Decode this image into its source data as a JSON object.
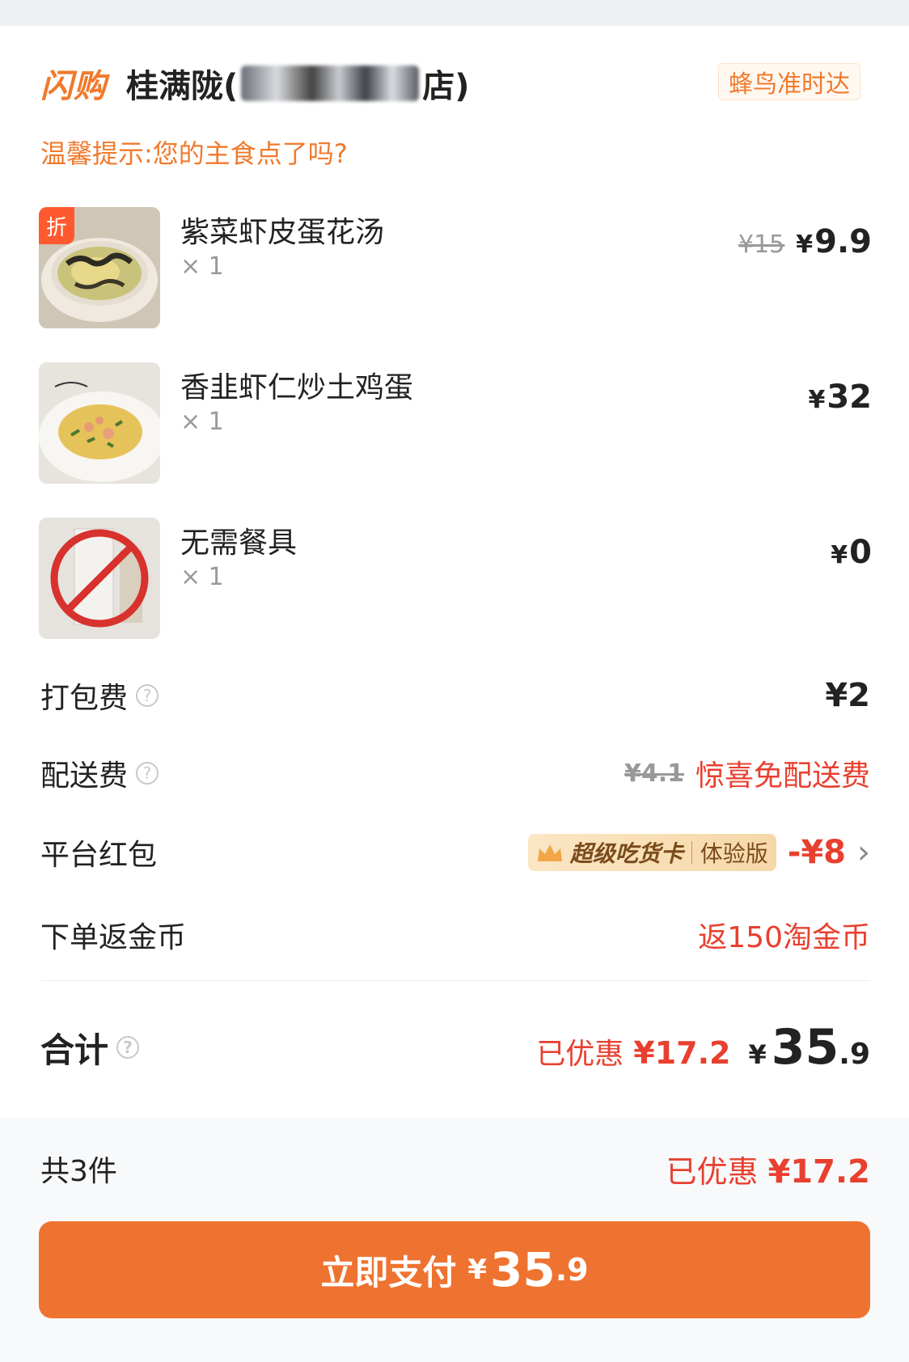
{
  "colors": {
    "accent": "#f07a2c",
    "red": "#e8402f",
    "pay_button": "#ef7330"
  },
  "header": {
    "brand": "闪购",
    "shop_name_prefix": "桂满陇(",
    "shop_name_suffix": "店)",
    "delivery_tag": "蜂鸟准时达"
  },
  "tip": "温馨提示:您的主食点了吗?",
  "items": [
    {
      "name": "紫菜虾皮蛋花汤",
      "qty": "× 1",
      "old_price": "¥15",
      "price_symbol": "¥",
      "price": "9.9",
      "badge": "折",
      "thumb_icon": "soup-image"
    },
    {
      "name": "香韭虾仁炒土鸡蛋",
      "qty": "× 1",
      "price_symbol": "¥",
      "price": "32",
      "thumb_icon": "egg-dish-image"
    },
    {
      "name": "无需餐具",
      "qty": "× 1",
      "price_symbol": "¥",
      "price": "0",
      "thumb_icon": "no-cutlery-image"
    }
  ],
  "fees": {
    "packing": {
      "label": "打包费",
      "value": "¥2"
    },
    "delivery": {
      "label": "配送费",
      "old_value": "¥4.1",
      "value": "惊喜免配送费"
    },
    "red_packet": {
      "label": "平台红包",
      "badge_main": "超级吃货卡",
      "badge_sub": "体验版",
      "value": "-¥8",
      "arrow": "›"
    },
    "coins": {
      "label": "下单返金币",
      "value": "返150淘金币"
    }
  },
  "total": {
    "label": "合计",
    "saved_label": "已优惠",
    "saved_value": "¥17.2",
    "price_symbol": "¥",
    "price_int": "35",
    "price_dec": ".9"
  },
  "footer": {
    "count": "共3件",
    "saved_label": "已优惠",
    "saved_value": "¥17.2"
  },
  "pay_button": {
    "label": "立即支付",
    "price_symbol": "¥",
    "price_int": "35",
    "price_dec": ".9"
  }
}
